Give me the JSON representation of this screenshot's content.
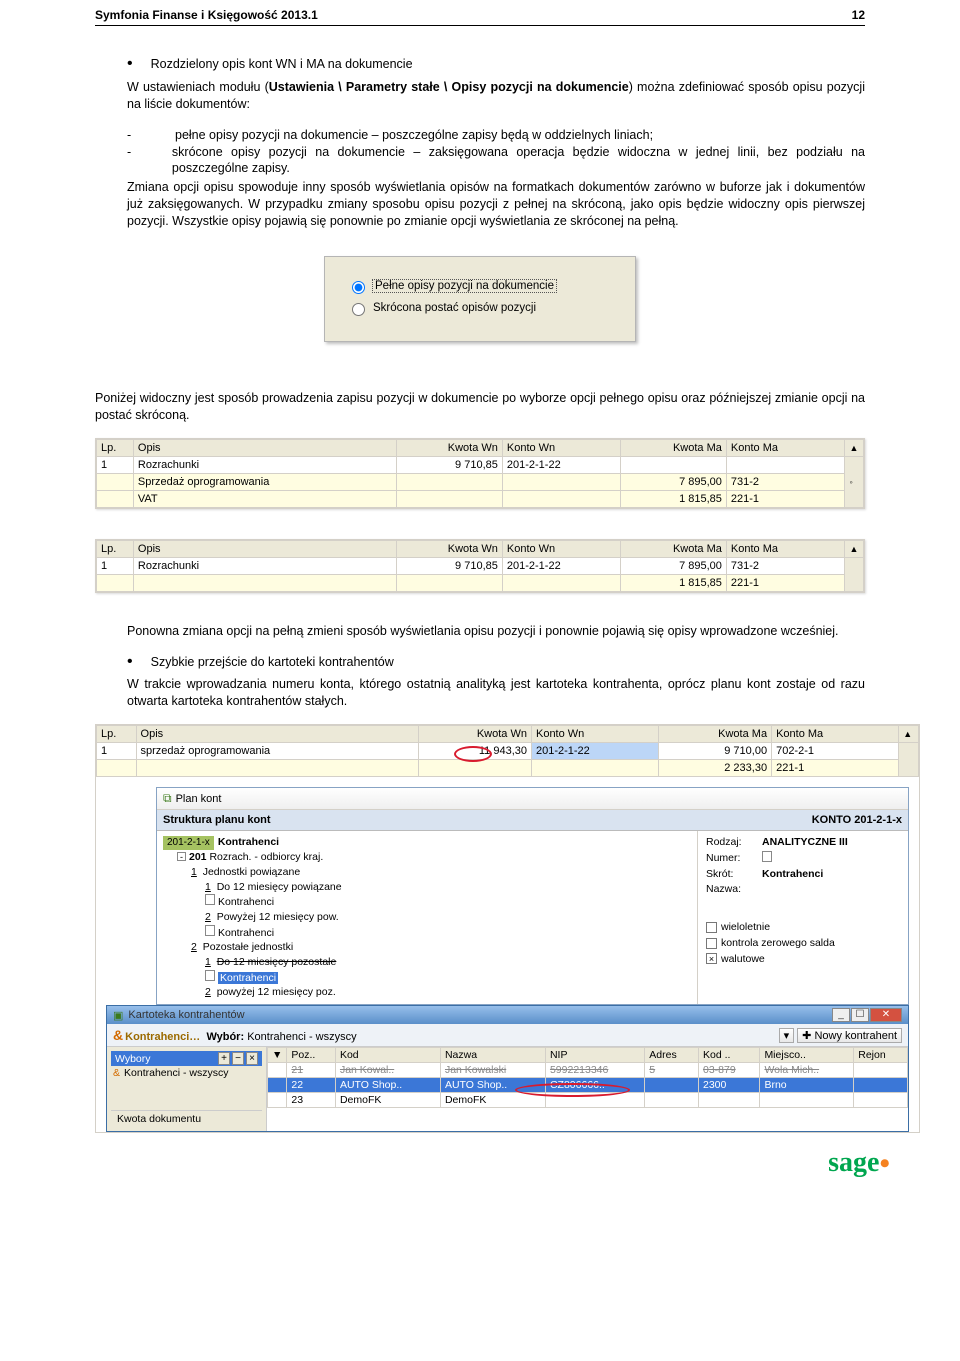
{
  "header": {
    "title": "Symfonia Finanse i Księgowość 2013.1",
    "page": "12"
  },
  "section1": {
    "bullet": "Rozdzielony opis kont WN i MA na dokumencie",
    "para_intro": "W ustawieniach modułu (",
    "para_bold1": "Ustawienia \\ Parametry stałe \\ Opisy pozycji na dokumencie",
    "para_after_bold": ") można zdefiniować sposób opisu pozycji na liście dokumentów:",
    "dash1": "pełne opisy pozycji na dokumencie – poszczególne zapisy będą w oddzielnych liniach;",
    "dash2": "skrócone opisy pozycji na dokumencie – zaksięgowana operacja będzie widoczna w jednej linii, bez podziału na poszczególne zapisy.",
    "para2": "Zmiana opcji opisu spowoduje inny sposób wyświetlania opisów na formatkach dokumentów zarówno w buforze jak i dokumentów już zaksięgowanych. W przypadku zmiany sposobu opisu pozycji z pełnej na skróconą, jako opis będzie widoczny opis pierwszej pozycji. Wszystkie opisy pojawią się ponownie po zmianie opcji wyświetlania ze skróconej na pełną."
  },
  "radio": {
    "opt1": "Pełne opisy pozycji na dokumencie",
    "opt2": "Skrócona postać opisów pozycji"
  },
  "mid_para": "Poniżej widoczny jest sposób prowadzenia zapisu pozycji w dokumencie po wyborze opcji pełnego opisu oraz późniejszej zmianie opcji na postać skróconą.",
  "table_headers": {
    "lp": "Lp.",
    "opis": "Opis",
    "kwotawn": "Kwota Wn",
    "kontown": "Konto Wn",
    "kwotama": "Kwota Ma",
    "kontoma": "Konto Ma"
  },
  "table1": {
    "rows": [
      {
        "lp": "1",
        "opis": "Rozrachunki",
        "kwotawn": "9 710,85",
        "kontown": "201-2-1-22",
        "kwotama": "",
        "kontoma": ""
      },
      {
        "lp": "",
        "opis": "Sprzedaż oprogramowania",
        "kwotawn": "",
        "kontown": "",
        "kwotama": "7 895,00",
        "kontoma": "731-2"
      },
      {
        "lp": "",
        "opis": "VAT",
        "kwotawn": "",
        "kontown": "",
        "kwotama": "1 815,85",
        "kontoma": "221-1"
      }
    ]
  },
  "table2": {
    "rows": [
      {
        "lp": "1",
        "opis": "Rozrachunki",
        "kwotawn": "9 710,85",
        "kontown": "201-2-1-22",
        "kwotama": "7 895,00",
        "kontoma": "731-2"
      },
      {
        "lp": "",
        "opis": "",
        "kwotawn": "",
        "kontown": "",
        "kwotama": "1 815,85",
        "kontoma": "221-1"
      }
    ]
  },
  "section2": {
    "para": "Ponowna zmiana opcji na pełną zmieni sposób wyświetlania opisu pozycji i ponownie pojawią się opisy wprowadzone wcześniej.",
    "bullet": "Szybkie przejście do kartoteki kontrahentów",
    "para2": "W trakcie wprowadzania numeru konta, którego ostatnią analityką jest kartoteka kontrahenta, oprócz planu kont zostaje od razu otwarta kartoteka kontrahentów stałych."
  },
  "table3": {
    "rows": [
      {
        "lp": "1",
        "opis": "sprzedaż oprogramowania",
        "kwotawn": "11 943,30",
        "kontown": "201-2-1-22",
        "kwotama": "9 710,00",
        "kontoma": "702-2-1"
      },
      {
        "lp": "",
        "opis": "",
        "kwotawn": "",
        "kontown": "",
        "kwotama": "2 233,30",
        "kontoma": "221-1"
      }
    ]
  },
  "plankont": {
    "win_title": "Plan kont",
    "header_left": "Struktura planu kont",
    "header_right": "KONTO  201-2-1-x",
    "chip": "201-2-1-x",
    "chip_label": "Kontrahenci",
    "node201": "201",
    "node201_desc": "Rozrach. - odbiorcy kraj.",
    "n1": "Jednostki powiązane",
    "n1_1": "Do 12 miesięcy powiązane",
    "n1_k": "Kontrahenci",
    "n2": "Powyżej 12 miesięcy pow.",
    "n2_k": "Kontrahenci",
    "n3": "Pozostałe jednostki",
    "n3_1": "Do 12 miesięcy pozostałe",
    "n3_k": "Kontrahenci",
    "n3_2": "powyżej 12 miesięcy poz.",
    "right": {
      "rodzaj_l": "Rodzaj:",
      "rodzaj_v": "ANALITYCZNE   III",
      "numer_l": "Numer:",
      "skrot_l": "Skrót:",
      "skrot_v": "Kontrahenci",
      "nazwa_l": "Nazwa:",
      "cb1": "wieloletnie",
      "cb2": "kontrola zerowego salda",
      "cb3": "walutowe"
    }
  },
  "kontr": {
    "win_title": "Kartoteka kontrahentów",
    "brand": "Kontrahenci…",
    "wybor_l": "Wybór:",
    "wybor_v": "Kontrahenci - wszyscy",
    "new_btn": "Nowy kontrahent",
    "left_title": "Wybory",
    "left_item": "Kontrahenci - wszyscy",
    "foot": "Kwota dokumentu",
    "headers": {
      "poz": "Poz..",
      "kod": "Kod",
      "nazwa": "Nazwa",
      "nip": "NIP",
      "adres": "Adres",
      "kod2": "Kod ..",
      "miejsc": "Miejsco..",
      "rejon": "Rejon"
    },
    "rows": [
      {
        "poz": "21",
        "kod": "Jan Kowal..",
        "nazwa": "Jan Kowalski",
        "nip": "5992213346",
        "adres": "5",
        "kod2": "03-879",
        "miejsc": "Wola Mich.."
      },
      {
        "poz": "22",
        "kod": "AUTO Shop..",
        "nazwa": "AUTO Shop..",
        "nip": "CZ806666..",
        "adres": "",
        "kod2": "2300",
        "miejsc": "Brno"
      },
      {
        "poz": "23",
        "kod": "DemoFK",
        "nazwa": "DemoFK",
        "nip": "",
        "adres": "",
        "kod2": "",
        "miejsc": ""
      }
    ]
  },
  "logo": "sage"
}
